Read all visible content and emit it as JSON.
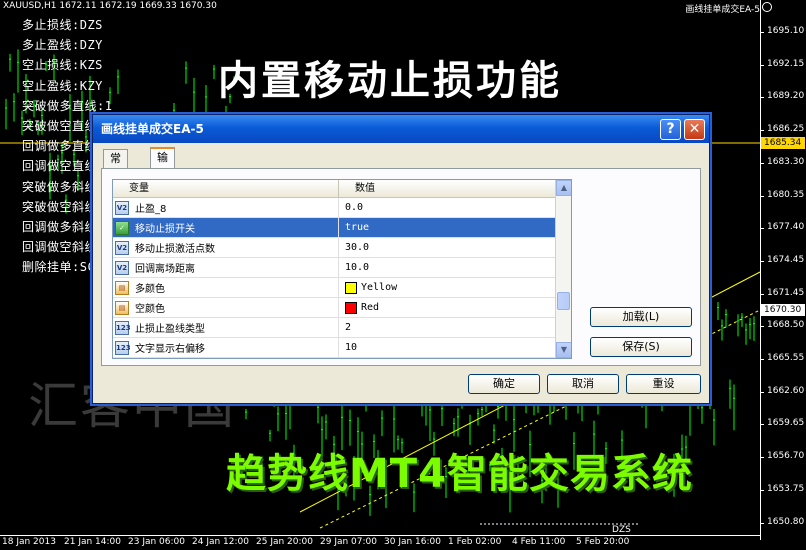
{
  "header": {
    "symbol_info": "XAUUSD,H1  1672.11 1672.19 1669.33 1670.30",
    "ea_name": "画线挂单成交EA-5"
  },
  "price_axis": {
    "ticks": [
      "1695.10",
      "1692.15",
      "1689.20",
      "1686.25",
      "1683.30",
      "1680.35",
      "1677.40",
      "1674.45",
      "1671.45",
      "1668.50",
      "1665.55",
      "1662.60",
      "1659.65",
      "1656.70",
      "1653.75",
      "1650.80"
    ],
    "current_price": "1670.30",
    "line_price": "1685.34"
  },
  "time_axis": {
    "ticks": [
      "18 Jan 2013",
      "21 Jan 14:00",
      "23 Jan 06:00",
      "24 Jan 12:00",
      "25 Jan 20:00",
      "29 Jan 07:00",
      "30 Jan 16:00",
      "1 Feb 02:00",
      "4 Feb 11:00",
      "5 Feb 20:00"
    ]
  },
  "menu_items": [
    "多止损线:DZS",
    "多止盈线:DZY",
    "空止损线:KZS",
    "空止盈线:KZY",
    "突破做多直线:1",
    "突破做空直线",
    "回调做多直线",
    "回调做空直线",
    "突破做多斜线",
    "突破做空斜线",
    "回调做多斜线",
    "回调做空斜线",
    "删除挂单:SC"
  ],
  "banner_top": "内置移动止损功能",
  "watermark": "汇客中国",
  "banner_bottom": "趋势线MT4智能交易系统",
  "bottom_label": "DZS",
  "dialog": {
    "title": "画线挂单成交EA-5",
    "tabs": [
      "常用",
      "输入参数"
    ],
    "active_tab": 1,
    "columns": {
      "variable": "变量",
      "value": "数值"
    },
    "rows": [
      {
        "icon": "double-icon",
        "icon_text": "V2",
        "name": "止盈_8",
        "value": "0.0",
        "swatch": null,
        "selected": false
      },
      {
        "icon": "bool-icon",
        "icon_text": "✓",
        "name": "移动止损开关",
        "value": "true",
        "swatch": null,
        "selected": true
      },
      {
        "icon": "double-icon",
        "icon_text": "V2",
        "name": "移动止损激活点数",
        "value": "30.0",
        "swatch": null,
        "selected": false
      },
      {
        "icon": "double-icon",
        "icon_text": "V2",
        "name": "回调离场距离",
        "value": "10.0",
        "swatch": null,
        "selected": false
      },
      {
        "icon": "color-icon",
        "icon_text": "▤",
        "name": "多颜色",
        "value": "Yellow",
        "swatch": "#ffff00",
        "selected": false
      },
      {
        "icon": "color-icon",
        "icon_text": "▤",
        "name": "空颜色",
        "value": "Red",
        "swatch": "#ff0000",
        "selected": false
      },
      {
        "icon": "int-icon",
        "icon_text": "123",
        "name": "止损止盈线类型",
        "value": "2",
        "swatch": null,
        "selected": false
      },
      {
        "icon": "int-icon",
        "icon_text": "123",
        "name": "文字显示右偏移",
        "value": "10",
        "swatch": null,
        "selected": false
      }
    ],
    "buttons": {
      "load": "加载(L)",
      "save": "保存(S)",
      "ok": "确定",
      "cancel": "取消",
      "reset": "重设"
    }
  },
  "colors": {
    "background": "#000000",
    "candles": "#00ff00",
    "price_line": "#ffd700",
    "trend_line": "#ffff00",
    "selection": "#316ac5"
  }
}
